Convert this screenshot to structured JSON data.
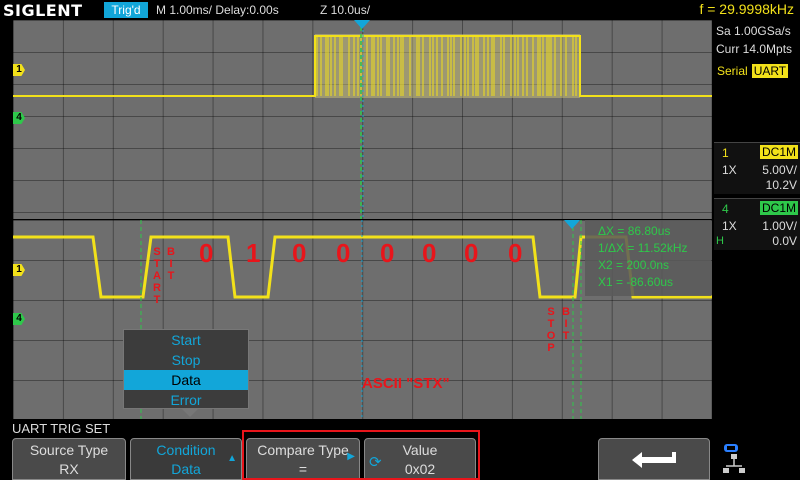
{
  "header": {
    "brand": "SIGLENT",
    "trigger_status": "Trig'd",
    "timebase": "M 1.00ms/ Delay:0.00s",
    "zoom": "Z 10.0us/",
    "frequency": "f = 29.9998kHz"
  },
  "acquisition": {
    "sample_rate": "Sa 1.00GSa/s",
    "memory": "Curr 14.0Mpts"
  },
  "decode": {
    "label": "Serial",
    "protocol": "UART"
  },
  "channels": [
    {
      "num": "1",
      "coupling": "DC1M",
      "probe": "1X",
      "volts_div": "5.00V/",
      "offset": "10.2V",
      "color": "#f2e11a"
    },
    {
      "num": "4",
      "coupling": "DC1M",
      "probe": "1X",
      "volts_div": "1.00V/",
      "offset": "0.0V",
      "color": "#2ec84a",
      "extra": "H"
    }
  ],
  "cursors": {
    "dx": "ΔX = 86.80us",
    "inv_dx": "1/ΔX = 11.52kHz",
    "x2": "X2 = 200.0ns",
    "x1": "X1 = -86.60us"
  },
  "annotations": {
    "start_letters": [
      "S",
      "T",
      "A",
      "R",
      "T"
    ],
    "bit_letters": [
      "B",
      "I",
      "T"
    ],
    "stop_letters": [
      "S",
      "T",
      "O",
      "P"
    ],
    "stop_bit_letters": [
      "B",
      "I",
      "T"
    ],
    "bits": [
      "0",
      "1",
      "0",
      "0",
      "0",
      "0",
      "0",
      "0"
    ],
    "ascii": "ASCII  \"STX\""
  },
  "condition_menu": {
    "options": [
      "Start",
      "Stop",
      "Data",
      "Error"
    ],
    "selected": "Data"
  },
  "bottom_menu": {
    "title": "UART TRIG SET",
    "source_type": {
      "label": "Source Type",
      "value": "RX"
    },
    "condition": {
      "label": "Condition",
      "value": "Data"
    },
    "compare_type": {
      "label": "Compare Type",
      "value": "="
    },
    "value": {
      "label": "Value",
      "value": "0x02"
    }
  },
  "icons": {
    "channel_marker": "arrow-marker",
    "trigger_position": "triangle-down",
    "back": "return-arrow-icon",
    "network": "network-icon"
  }
}
